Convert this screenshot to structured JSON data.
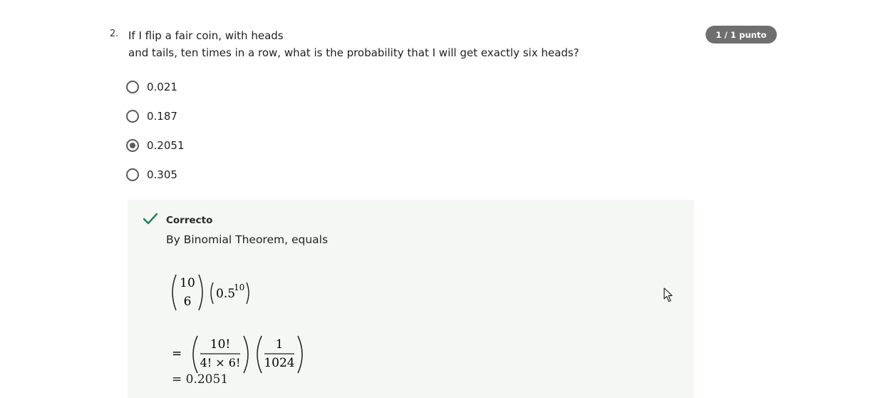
{
  "question": {
    "number": "2.",
    "text_line1": "If I flip a fair coin, with heads",
    "text_line2": "and tails, ten times in a row, what is the probability that I will get exactly six heads?",
    "points": "1 / 1 punto"
  },
  "options": [
    {
      "label": "0.021",
      "selected": false
    },
    {
      "label": "0.187",
      "selected": false
    },
    {
      "label": "0.2051",
      "selected": true
    },
    {
      "label": "0.305",
      "selected": false
    }
  ],
  "feedback": {
    "status": "Correcto",
    "status_color": "#1f8354",
    "explanation": "By Binomial Theorem, equals",
    "math": {
      "binom_top": "10",
      "binom_bottom": "6",
      "base": "0.5",
      "exponent": "10",
      "equals": "=",
      "frac1_num": "10!",
      "frac1_den": "4! × 6!",
      "frac2_num": "1",
      "frac2_den": "1024",
      "result": "= 0.2051"
    }
  },
  "icons": {
    "check": "check-icon",
    "cursor": "mouse-pointer-icon"
  }
}
